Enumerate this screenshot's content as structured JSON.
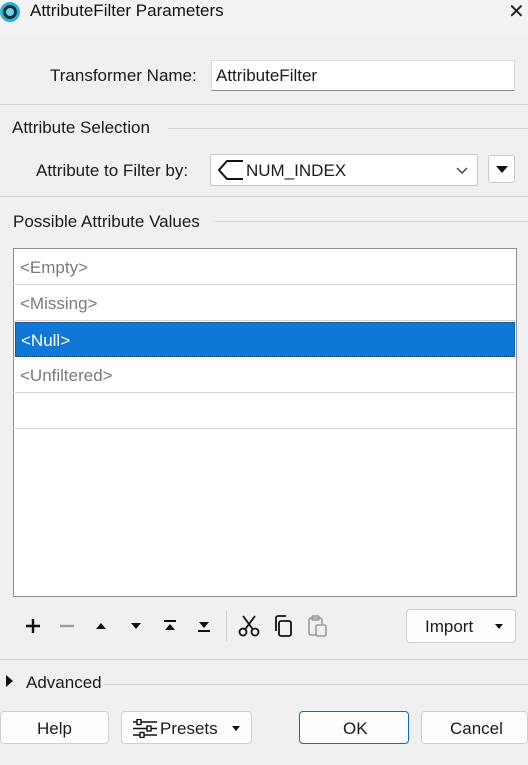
{
  "window": {
    "title": "AttributeFilter Parameters"
  },
  "transformer": {
    "name_label": "Transformer Name:",
    "name_value": "AttributeFilter"
  },
  "attribute_selection": {
    "section_label": "Attribute Selection",
    "filter_label": "Attribute to Filter by:",
    "filter_value": "NUM_INDEX"
  },
  "possible_values": {
    "section_label": "Possible Attribute Values",
    "rows": [
      "<Empty>",
      "<Missing>",
      "<Null>",
      "<Unfiltered>",
      ""
    ],
    "selected_index": 2
  },
  "toolbar": {
    "icons": [
      "add-icon",
      "remove-icon",
      "move-up-icon",
      "move-down-icon",
      "move-top-icon",
      "move-bottom-icon",
      "cut-icon",
      "copy-icon",
      "paste-icon"
    ],
    "import_label": "Import"
  },
  "advanced": {
    "label": "Advanced"
  },
  "footer": {
    "help_label": "Help",
    "presets_label": "Presets",
    "ok_label": "OK",
    "cancel_label": "Cancel"
  },
  "colors": {
    "selection": "#0f78d4",
    "accent_border": "#0f6cbd"
  }
}
